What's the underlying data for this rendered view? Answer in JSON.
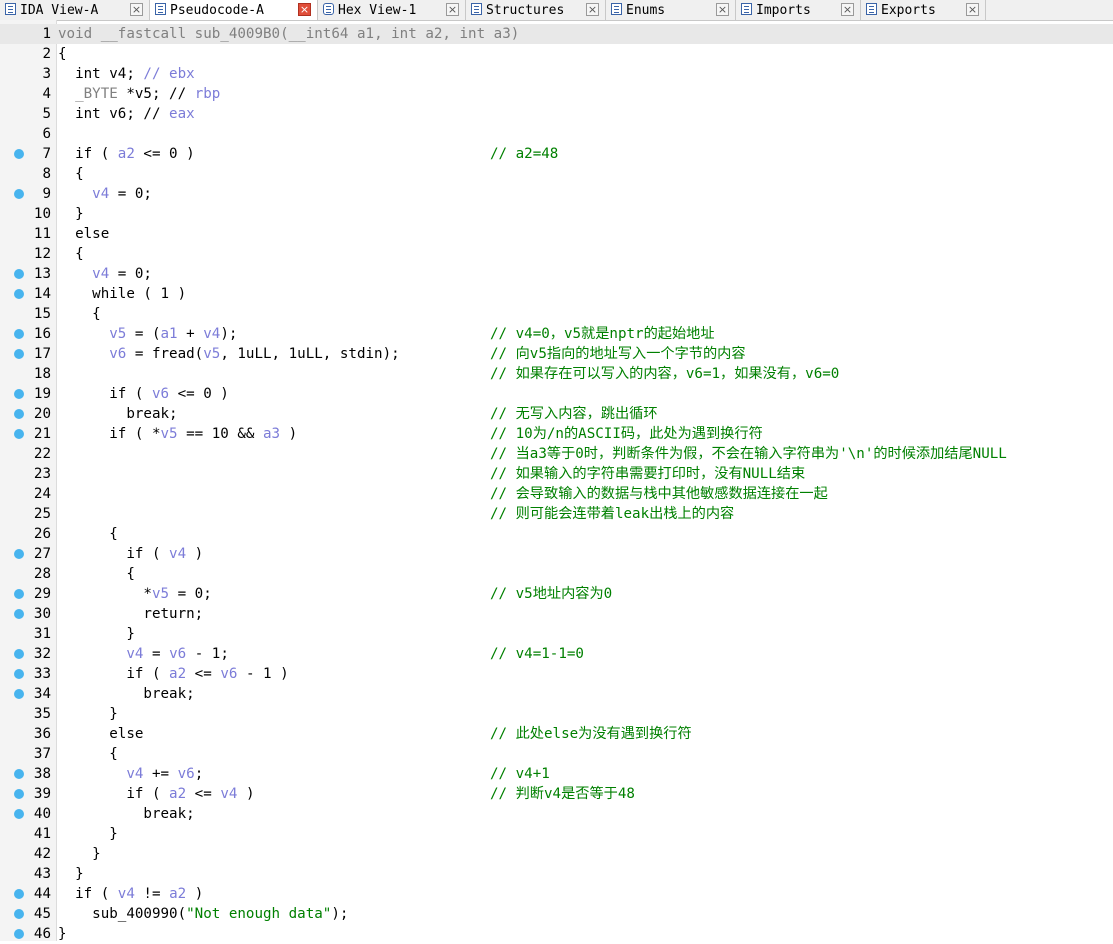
{
  "tabs": [
    {
      "label": "IDA View-A",
      "icon": "ida-view-icon",
      "active": false,
      "width": 150
    },
    {
      "label": "Pseudocode-A",
      "icon": "pseudocode-icon",
      "active": true,
      "width": 168
    },
    {
      "label": "Hex View-1",
      "icon": "hex-view-icon",
      "active": false,
      "width": 148
    },
    {
      "label": "Structures",
      "icon": "structures-icon",
      "active": false,
      "width": 140
    },
    {
      "label": "Enums",
      "icon": "enums-icon",
      "active": false,
      "width": 130
    },
    {
      "label": "Imports",
      "icon": "imports-icon",
      "active": false,
      "width": 125
    },
    {
      "label": "Exports",
      "icon": "exports-icon",
      "active": false,
      "width": 125
    }
  ],
  "close_glyph": "×",
  "colors": {
    "breakpoint": "#48b4ee",
    "comment": "#008000",
    "variable": "#7c7cd8",
    "dim": "#808080",
    "active_close": "#e04e3a"
  },
  "lines": [
    {
      "n": "1",
      "bp": false,
      "hl": true,
      "code": [
        [
          "void __fastcall sub_4009B0(__int64 ",
          "grey"
        ],
        [
          "a1",
          "grey"
        ],
        [
          ", int ",
          "grey"
        ],
        [
          "a2",
          "grey"
        ],
        [
          ", int ",
          "grey"
        ],
        [
          "a3",
          "grey"
        ],
        [
          ")",
          "grey"
        ]
      ],
      "comment": ""
    },
    {
      "n": "2",
      "bp": false,
      "code": [
        [
          "{",
          ""
        ]
      ],
      "comment": ""
    },
    {
      "n": "3",
      "bp": false,
      "code": [
        [
          "  int v4; ",
          ""
        ],
        [
          "// ebx",
          "var"
        ]
      ],
      "comment": ""
    },
    {
      "n": "4",
      "bp": false,
      "code": [
        [
          "  _BYTE ",
          "grey"
        ],
        [
          "*v5; // ",
          ""
        ],
        [
          "rbp",
          "var"
        ]
      ],
      "comment": ""
    },
    {
      "n": "5",
      "bp": false,
      "code": [
        [
          "  int v6; // ",
          ""
        ],
        [
          "eax",
          "var"
        ]
      ],
      "comment": ""
    },
    {
      "n": "6",
      "bp": false,
      "code": [],
      "comment": ""
    },
    {
      "n": "7",
      "bp": true,
      "code": [
        [
          "  if ( ",
          ""
        ],
        [
          "a2",
          "var"
        ],
        [
          " <= 0 )",
          ""
        ]
      ],
      "comment": "// a2=48"
    },
    {
      "n": "8",
      "bp": false,
      "code": [
        [
          "  {",
          ""
        ]
      ],
      "comment": ""
    },
    {
      "n": "9",
      "bp": true,
      "code": [
        [
          "    ",
          ""
        ],
        [
          "v4",
          "var"
        ],
        [
          " = 0;",
          ""
        ]
      ],
      "comment": ""
    },
    {
      "n": "10",
      "bp": false,
      "code": [
        [
          "  }",
          ""
        ]
      ],
      "comment": ""
    },
    {
      "n": "11",
      "bp": false,
      "code": [
        [
          "  else",
          ""
        ]
      ],
      "comment": ""
    },
    {
      "n": "12",
      "bp": false,
      "code": [
        [
          "  {",
          ""
        ]
      ],
      "comment": ""
    },
    {
      "n": "13",
      "bp": true,
      "code": [
        [
          "    ",
          ""
        ],
        [
          "v4",
          "var"
        ],
        [
          " = 0;",
          ""
        ]
      ],
      "comment": ""
    },
    {
      "n": "14",
      "bp": true,
      "code": [
        [
          "    while ( 1 )",
          ""
        ]
      ],
      "comment": ""
    },
    {
      "n": "15",
      "bp": false,
      "code": [
        [
          "    {",
          ""
        ]
      ],
      "comment": ""
    },
    {
      "n": "16",
      "bp": true,
      "code": [
        [
          "      ",
          ""
        ],
        [
          "v5",
          "var"
        ],
        [
          " = (",
          ""
        ],
        [
          "a1",
          "var"
        ],
        [
          " + ",
          ""
        ],
        [
          "v4",
          "var"
        ],
        [
          ");",
          ""
        ]
      ],
      "comment": "// v4=0，v5就是nptr的起始地址"
    },
    {
      "n": "17",
      "bp": true,
      "code": [
        [
          "      ",
          ""
        ],
        [
          "v6",
          "var"
        ],
        [
          " = fread(",
          ""
        ],
        [
          "v5",
          "var"
        ],
        [
          ", 1uLL, 1uLL, stdin);",
          ""
        ]
      ],
      "comment": "// 向v5指向的地址写入一个字节的内容"
    },
    {
      "n": "18",
      "bp": false,
      "code": [],
      "comment": "// 如果存在可以写入的内容，v6=1，如果没有，v6=0"
    },
    {
      "n": "19",
      "bp": true,
      "code": [
        [
          "      if ( ",
          ""
        ],
        [
          "v6",
          "var"
        ],
        [
          " <= 0 )",
          ""
        ]
      ],
      "comment": ""
    },
    {
      "n": "20",
      "bp": true,
      "code": [
        [
          "        break;",
          ""
        ]
      ],
      "comment": "// 无写入内容，跳出循环"
    },
    {
      "n": "21",
      "bp": true,
      "code": [
        [
          "      if ( *",
          ""
        ],
        [
          "v5",
          "var"
        ],
        [
          " == 10 && ",
          ""
        ],
        [
          "a3",
          "var"
        ],
        [
          " )",
          ""
        ]
      ],
      "comment": "// 10为/n的ASCII码，此处为遇到换行符"
    },
    {
      "n": "22",
      "bp": false,
      "code": [],
      "comment": "// 当a3等于0时，判断条件为假，不会在输入字符串为'\\n'的时候添加结尾NULL"
    },
    {
      "n": "23",
      "bp": false,
      "code": [],
      "comment": "// 如果输入的字符串需要打印时，没有NULL结束"
    },
    {
      "n": "24",
      "bp": false,
      "code": [],
      "comment": "// 会导致输入的数据与栈中其他敏感数据连接在一起"
    },
    {
      "n": "25",
      "bp": false,
      "code": [],
      "comment": "// 则可能会连带着leak出栈上的内容"
    },
    {
      "n": "26",
      "bp": false,
      "code": [
        [
          "      {",
          ""
        ]
      ],
      "comment": ""
    },
    {
      "n": "27",
      "bp": true,
      "code": [
        [
          "        if ( ",
          ""
        ],
        [
          "v4",
          "var"
        ],
        [
          " )",
          ""
        ]
      ],
      "comment": ""
    },
    {
      "n": "28",
      "bp": false,
      "code": [
        [
          "        {",
          ""
        ]
      ],
      "comment": ""
    },
    {
      "n": "29",
      "bp": true,
      "code": [
        [
          "          *",
          ""
        ],
        [
          "v5",
          "var"
        ],
        [
          " = 0;",
          ""
        ]
      ],
      "comment": "// v5地址内容为0"
    },
    {
      "n": "30",
      "bp": true,
      "code": [
        [
          "          return;",
          ""
        ]
      ],
      "comment": ""
    },
    {
      "n": "31",
      "bp": false,
      "code": [
        [
          "        }",
          ""
        ]
      ],
      "comment": ""
    },
    {
      "n": "32",
      "bp": true,
      "code": [
        [
          "        ",
          ""
        ],
        [
          "v4",
          "var"
        ],
        [
          " = ",
          ""
        ],
        [
          "v6",
          "var"
        ],
        [
          " - 1;",
          ""
        ]
      ],
      "comment": "// v4=1-1=0"
    },
    {
      "n": "33",
      "bp": true,
      "code": [
        [
          "        if ( ",
          ""
        ],
        [
          "a2",
          "var"
        ],
        [
          " <= ",
          ""
        ],
        [
          "v6",
          "var"
        ],
        [
          " - 1 )",
          ""
        ]
      ],
      "comment": ""
    },
    {
      "n": "34",
      "bp": true,
      "code": [
        [
          "          break;",
          ""
        ]
      ],
      "comment": ""
    },
    {
      "n": "35",
      "bp": false,
      "code": [
        [
          "      }",
          ""
        ]
      ],
      "comment": ""
    },
    {
      "n": "36",
      "bp": false,
      "code": [
        [
          "      else",
          ""
        ]
      ],
      "comment": "// 此处else为没有遇到换行符"
    },
    {
      "n": "37",
      "bp": false,
      "code": [
        [
          "      {",
          ""
        ]
      ],
      "comment": ""
    },
    {
      "n": "38",
      "bp": true,
      "code": [
        [
          "        ",
          ""
        ],
        [
          "v4",
          "var"
        ],
        [
          " += ",
          ""
        ],
        [
          "v6",
          "var"
        ],
        [
          ";",
          ""
        ]
      ],
      "comment": "// v4+1"
    },
    {
      "n": "39",
      "bp": true,
      "code": [
        [
          "        if ( ",
          ""
        ],
        [
          "a2",
          "var"
        ],
        [
          " <= ",
          ""
        ],
        [
          "v4",
          "var"
        ],
        [
          " )",
          ""
        ]
      ],
      "comment": "// 判断v4是否等于48"
    },
    {
      "n": "40",
      "bp": true,
      "code": [
        [
          "          break;",
          ""
        ]
      ],
      "comment": ""
    },
    {
      "n": "41",
      "bp": false,
      "code": [
        [
          "      }",
          ""
        ]
      ],
      "comment": ""
    },
    {
      "n": "42",
      "bp": false,
      "code": [
        [
          "    }",
          ""
        ]
      ],
      "comment": ""
    },
    {
      "n": "43",
      "bp": false,
      "code": [
        [
          "  }",
          ""
        ]
      ],
      "comment": ""
    },
    {
      "n": "44",
      "bp": true,
      "code": [
        [
          "  if ( ",
          ""
        ],
        [
          "v4",
          "var"
        ],
        [
          " != ",
          ""
        ],
        [
          "a2",
          "var"
        ],
        [
          " )",
          ""
        ]
      ],
      "comment": ""
    },
    {
      "n": "45",
      "bp": true,
      "code": [
        [
          "    sub_400990(",
          ""
        ],
        [
          "\"Not enough data\"",
          "str"
        ],
        [
          ");",
          ""
        ]
      ],
      "comment": ""
    },
    {
      "n": "46",
      "bp": true,
      "code": [
        [
          "}",
          ""
        ]
      ],
      "comment": ""
    }
  ]
}
